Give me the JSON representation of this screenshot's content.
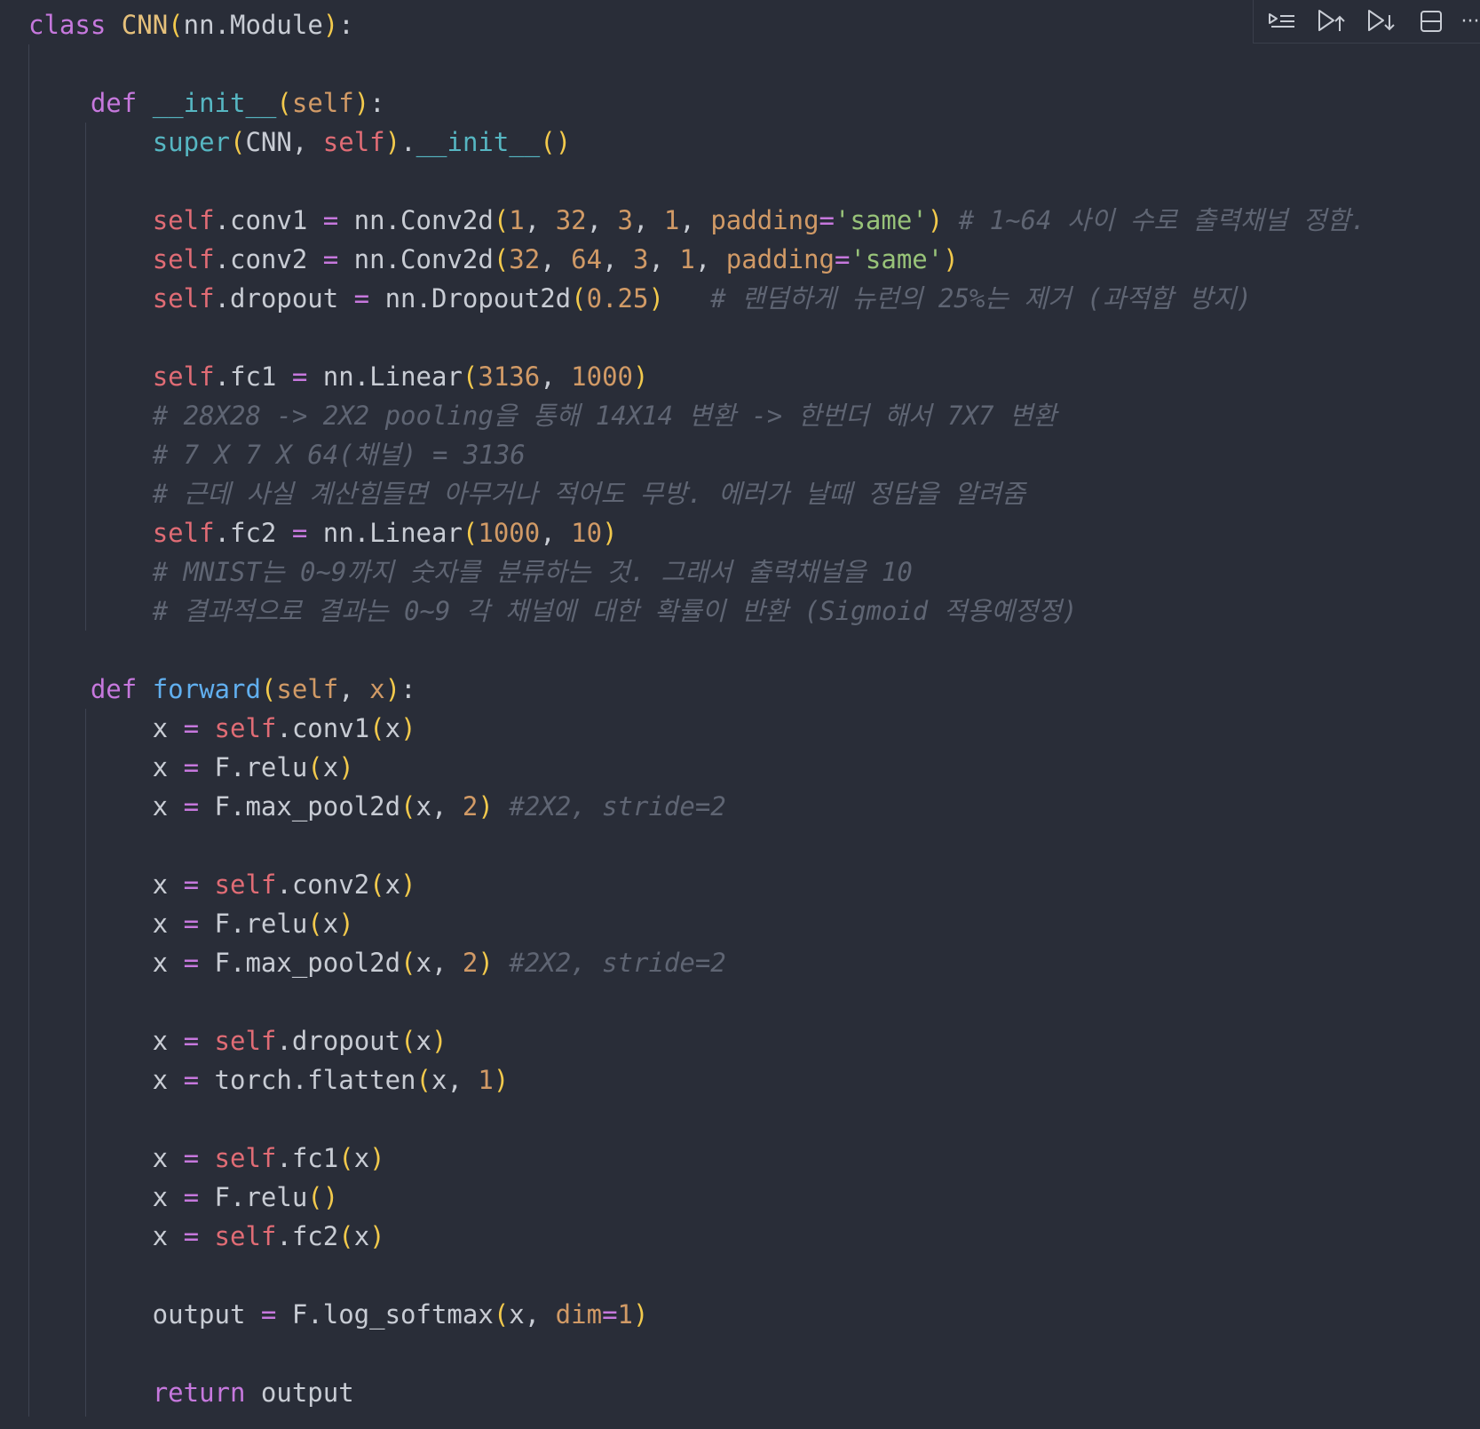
{
  "editor": {
    "language": "python",
    "lines": [
      [
        [
          "keyword",
          "class"
        ],
        [
          "plain",
          " "
        ],
        [
          "class",
          "CNN"
        ],
        [
          "paren",
          "("
        ],
        [
          "plain",
          "nn.Module"
        ],
        [
          "paren",
          ")"
        ],
        [
          "punct",
          ":"
        ]
      ],
      [],
      [
        [
          "plain",
          "    "
        ],
        [
          "keyword",
          "def"
        ],
        [
          "plain",
          " "
        ],
        [
          "dunder",
          "__init__"
        ],
        [
          "paren",
          "("
        ],
        [
          "param",
          "self"
        ],
        [
          "paren",
          ")"
        ],
        [
          "punct",
          ":"
        ]
      ],
      [
        [
          "plain",
          "        "
        ],
        [
          "builtin",
          "super"
        ],
        [
          "paren",
          "("
        ],
        [
          "plain",
          "CNN, "
        ],
        [
          "self",
          "self"
        ],
        [
          "paren",
          ")"
        ],
        [
          "plain",
          "."
        ],
        [
          "dunder",
          "__init__"
        ],
        [
          "paren",
          "()"
        ]
      ],
      [],
      [
        [
          "plain",
          "        "
        ],
        [
          "self",
          "self"
        ],
        [
          "plain",
          ".conv1 "
        ],
        [
          "op",
          "="
        ],
        [
          "plain",
          " nn.Conv2d"
        ],
        [
          "paren",
          "("
        ],
        [
          "number",
          "1"
        ],
        [
          "plain",
          ", "
        ],
        [
          "number",
          "32"
        ],
        [
          "plain",
          ", "
        ],
        [
          "number",
          "3"
        ],
        [
          "plain",
          ", "
        ],
        [
          "number",
          "1"
        ],
        [
          "plain",
          ", "
        ],
        [
          "kwarg",
          "padding"
        ],
        [
          "op",
          "="
        ],
        [
          "string",
          "'same'"
        ],
        [
          "paren",
          ")"
        ],
        [
          "plain",
          " "
        ],
        [
          "comment",
          "# 1~64 사이 수로 출력채널 정함."
        ]
      ],
      [
        [
          "plain",
          "        "
        ],
        [
          "self",
          "self"
        ],
        [
          "plain",
          ".conv2 "
        ],
        [
          "op",
          "="
        ],
        [
          "plain",
          " nn.Conv2d"
        ],
        [
          "paren",
          "("
        ],
        [
          "number",
          "32"
        ],
        [
          "plain",
          ", "
        ],
        [
          "number",
          "64"
        ],
        [
          "plain",
          ", "
        ],
        [
          "number",
          "3"
        ],
        [
          "plain",
          ", "
        ],
        [
          "number",
          "1"
        ],
        [
          "plain",
          ", "
        ],
        [
          "kwarg",
          "padding"
        ],
        [
          "op",
          "="
        ],
        [
          "string",
          "'same'"
        ],
        [
          "paren",
          ")"
        ]
      ],
      [
        [
          "plain",
          "        "
        ],
        [
          "self",
          "self"
        ],
        [
          "plain",
          ".dropout "
        ],
        [
          "op",
          "="
        ],
        [
          "plain",
          " nn.Dropout2d"
        ],
        [
          "paren",
          "("
        ],
        [
          "number",
          "0.25"
        ],
        [
          "paren",
          ")"
        ],
        [
          "plain",
          "   "
        ],
        [
          "comment",
          "# 랜덤하게 뉴런의 25%는 제거 (과적합 방지)"
        ]
      ],
      [],
      [
        [
          "plain",
          "        "
        ],
        [
          "self",
          "self"
        ],
        [
          "plain",
          ".fc1 "
        ],
        [
          "op",
          "="
        ],
        [
          "plain",
          " nn.Linear"
        ],
        [
          "paren",
          "("
        ],
        [
          "number",
          "3136"
        ],
        [
          "plain",
          ", "
        ],
        [
          "number",
          "1000"
        ],
        [
          "paren",
          ")"
        ]
      ],
      [
        [
          "plain",
          "        "
        ],
        [
          "comment",
          "# 28X28 -> 2X2 pooling을 통해 14X14 변환 -> 한번더 해서 7X7 변환"
        ]
      ],
      [
        [
          "plain",
          "        "
        ],
        [
          "comment",
          "# 7 X 7 X 64(채널) = 3136"
        ]
      ],
      [
        [
          "plain",
          "        "
        ],
        [
          "comment",
          "# 근데 사실 계산힘들면 아무거나 적어도 무방. 에러가 날때 정답을 알려줌"
        ]
      ],
      [
        [
          "plain",
          "        "
        ],
        [
          "self",
          "self"
        ],
        [
          "plain",
          ".fc2 "
        ],
        [
          "op",
          "="
        ],
        [
          "plain",
          " nn.Linear"
        ],
        [
          "paren",
          "("
        ],
        [
          "number",
          "1000"
        ],
        [
          "plain",
          ", "
        ],
        [
          "number",
          "10"
        ],
        [
          "paren",
          ")"
        ]
      ],
      [
        [
          "plain",
          "        "
        ],
        [
          "comment",
          "# MNIST는 0~9까지 숫자를 분류하는 것. 그래서 출력채널을 10"
        ]
      ],
      [
        [
          "plain",
          "        "
        ],
        [
          "comment",
          "# 결과적으로 결과는 0~9 각 채널에 대한 확률이 반환 (Sigmoid 적용예정정)"
        ]
      ],
      [],
      [
        [
          "plain",
          "    "
        ],
        [
          "keyword",
          "def"
        ],
        [
          "plain",
          " "
        ],
        [
          "func",
          "forward"
        ],
        [
          "paren",
          "("
        ],
        [
          "param",
          "self"
        ],
        [
          "plain",
          ", "
        ],
        [
          "param",
          "x"
        ],
        [
          "paren",
          ")"
        ],
        [
          "punct",
          ":"
        ]
      ],
      [
        [
          "plain",
          "        x "
        ],
        [
          "op",
          "="
        ],
        [
          "plain",
          " "
        ],
        [
          "self",
          "self"
        ],
        [
          "plain",
          ".conv1"
        ],
        [
          "paren",
          "("
        ],
        [
          "plain",
          "x"
        ],
        [
          "paren",
          ")"
        ]
      ],
      [
        [
          "plain",
          "        x "
        ],
        [
          "op",
          "="
        ],
        [
          "plain",
          " F.relu"
        ],
        [
          "paren",
          "("
        ],
        [
          "plain",
          "x"
        ],
        [
          "paren",
          ")"
        ]
      ],
      [
        [
          "plain",
          "        x "
        ],
        [
          "op",
          "="
        ],
        [
          "plain",
          " F.max_pool2d"
        ],
        [
          "paren",
          "("
        ],
        [
          "plain",
          "x, "
        ],
        [
          "number",
          "2"
        ],
        [
          "paren",
          ")"
        ],
        [
          "plain",
          " "
        ],
        [
          "comment",
          "#2X2, stride=2"
        ]
      ],
      [],
      [
        [
          "plain",
          "        x "
        ],
        [
          "op",
          "="
        ],
        [
          "plain",
          " "
        ],
        [
          "self",
          "self"
        ],
        [
          "plain",
          ".conv2"
        ],
        [
          "paren",
          "("
        ],
        [
          "plain",
          "x"
        ],
        [
          "paren",
          ")"
        ]
      ],
      [
        [
          "plain",
          "        x "
        ],
        [
          "op",
          "="
        ],
        [
          "plain",
          " F.relu"
        ],
        [
          "paren",
          "("
        ],
        [
          "plain",
          "x"
        ],
        [
          "paren",
          ")"
        ]
      ],
      [
        [
          "plain",
          "        x "
        ],
        [
          "op",
          "="
        ],
        [
          "plain",
          " F.max_pool2d"
        ],
        [
          "paren",
          "("
        ],
        [
          "plain",
          "x, "
        ],
        [
          "number",
          "2"
        ],
        [
          "paren",
          ")"
        ],
        [
          "plain",
          " "
        ],
        [
          "comment",
          "#2X2, stride=2"
        ]
      ],
      [],
      [
        [
          "plain",
          "        x "
        ],
        [
          "op",
          "="
        ],
        [
          "plain",
          " "
        ],
        [
          "self",
          "self"
        ],
        [
          "plain",
          ".dropout"
        ],
        [
          "paren",
          "("
        ],
        [
          "plain",
          "x"
        ],
        [
          "paren",
          ")"
        ]
      ],
      [
        [
          "plain",
          "        x "
        ],
        [
          "op",
          "="
        ],
        [
          "plain",
          " torch.flatten"
        ],
        [
          "paren",
          "("
        ],
        [
          "plain",
          "x, "
        ],
        [
          "number",
          "1"
        ],
        [
          "paren",
          ")"
        ]
      ],
      [],
      [
        [
          "plain",
          "        x "
        ],
        [
          "op",
          "="
        ],
        [
          "plain",
          " "
        ],
        [
          "self",
          "self"
        ],
        [
          "plain",
          ".fc1"
        ],
        [
          "paren",
          "("
        ],
        [
          "plain",
          "x"
        ],
        [
          "paren",
          ")"
        ]
      ],
      [
        [
          "plain",
          "        x "
        ],
        [
          "op",
          "="
        ],
        [
          "plain",
          " F.relu"
        ],
        [
          "paren",
          "()"
        ]
      ],
      [
        [
          "plain",
          "        x "
        ],
        [
          "op",
          "="
        ],
        [
          "plain",
          " "
        ],
        [
          "self",
          "self"
        ],
        [
          "plain",
          ".fc2"
        ],
        [
          "paren",
          "("
        ],
        [
          "plain",
          "x"
        ],
        [
          "paren",
          ")"
        ]
      ],
      [],
      [
        [
          "plain",
          "        output "
        ],
        [
          "op",
          "="
        ],
        [
          "plain",
          " F.log_softmax"
        ],
        [
          "paren",
          "("
        ],
        [
          "plain",
          "x, "
        ],
        [
          "kwarg",
          "dim"
        ],
        [
          "op",
          "="
        ],
        [
          "number",
          "1"
        ],
        [
          "paren",
          ")"
        ]
      ],
      [],
      [
        [
          "plain",
          "        "
        ],
        [
          "keyword",
          "return"
        ],
        [
          "plain",
          " output"
        ]
      ]
    ]
  },
  "toolbar": {
    "buttons": [
      {
        "icon": "run-by-line-icon",
        "name": "run-by-line-button"
      },
      {
        "icon": "execute-above-icon",
        "name": "execute-above-button"
      },
      {
        "icon": "execute-below-icon",
        "name": "execute-below-button"
      },
      {
        "icon": "split-cell-icon",
        "name": "split-cell-button"
      }
    ],
    "more_label": "···"
  },
  "colors": {
    "background": "#292d38",
    "keyword": "#c678dd",
    "class": "#e5c07b",
    "function": "#61afef",
    "builtin": "#56b6c2",
    "self": "#e06c75",
    "number": "#d19a66",
    "string": "#98c379",
    "bracket": "#f2c94c",
    "comment": "#5f6573",
    "text": "#c8ccd4"
  }
}
